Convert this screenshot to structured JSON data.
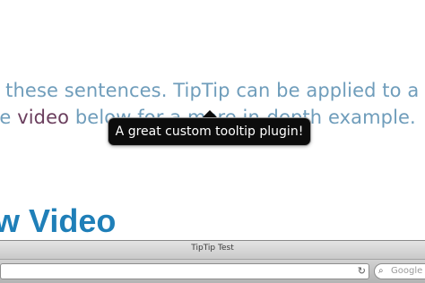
{
  "content": {
    "line1": "n these sentences. TipTip can be applied to a",
    "line2_before": "he ",
    "line2_link": "video",
    "line2_after": " below for a more in-depth example.",
    "heading": "w Video"
  },
  "tooltip": {
    "text": "A great custom tooltip plugin!"
  },
  "browser": {
    "title": "TipTip Test",
    "reload_icon": "↻",
    "search_icon": "⌕",
    "search_placeholder": "Google"
  },
  "colors": {
    "body_text": "#6f9dbb",
    "link": "#6b3f5e",
    "heading": "#1f7fb8",
    "tooltip_bg": "#0c0c0c"
  }
}
